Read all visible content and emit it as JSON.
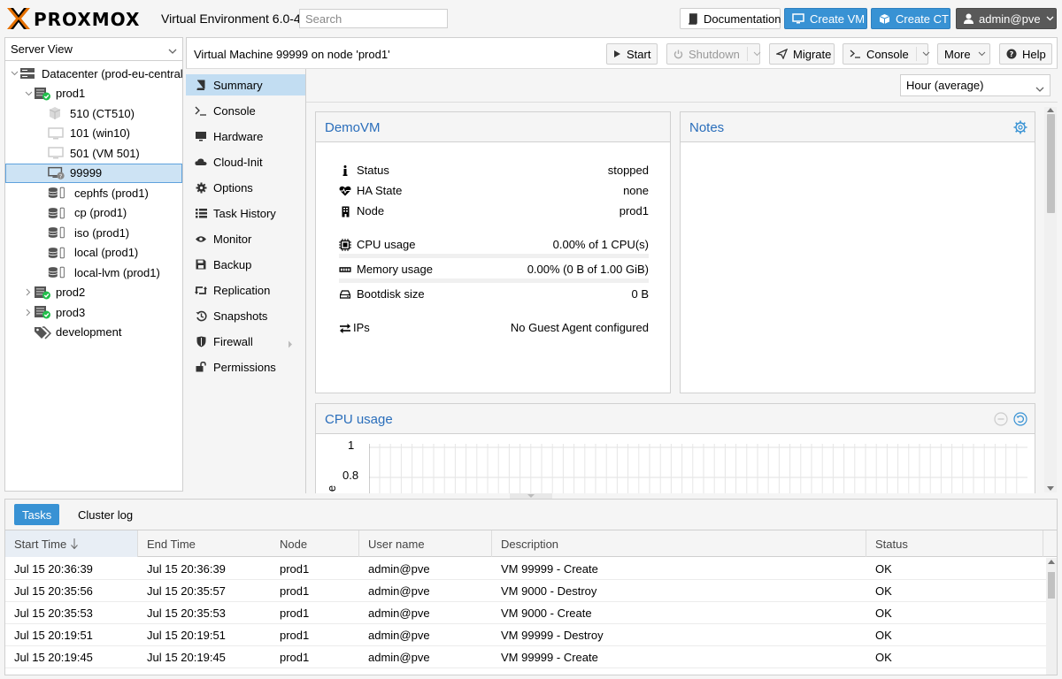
{
  "header": {
    "logo_text": "PROXMOX",
    "version": "Virtual Environment 6.0-4",
    "search_placeholder": "Search",
    "documentation_label": "Documentation",
    "create_vm_label": "Create VM",
    "create_ct_label": "Create CT",
    "user_label": "admin@pve"
  },
  "sidebar": {
    "view": "Server View",
    "tree": [
      {
        "label": "Datacenter (prod-eu-central)",
        "type": "datacenter"
      },
      {
        "label": "prod1",
        "type": "node"
      },
      {
        "label": "510 (CT510)",
        "type": "ct"
      },
      {
        "label": "101 (win10)",
        "type": "vm"
      },
      {
        "label": "501 (VM 501)",
        "type": "vm"
      },
      {
        "label": "99999",
        "type": "vm-unknown",
        "selected": true
      },
      {
        "label": "cephfs (prod1)",
        "type": "storage"
      },
      {
        "label": "cp (prod1)",
        "type": "storage"
      },
      {
        "label": "iso (prod1)",
        "type": "storage"
      },
      {
        "label": "local (prod1)",
        "type": "storage"
      },
      {
        "label": "local-lvm (prod1)",
        "type": "storage"
      },
      {
        "label": "prod2",
        "type": "node"
      },
      {
        "label": "prod3",
        "type": "node"
      },
      {
        "label": "development",
        "type": "tag"
      }
    ]
  },
  "toolbar": {
    "title": "Virtual Machine 99999 on node 'prod1'",
    "start_label": "Start",
    "shutdown_label": "Shutdown",
    "migrate_label": "Migrate",
    "console_label": "Console",
    "more_label": "More",
    "help_label": "Help"
  },
  "submenu": {
    "items": [
      {
        "label": "Summary",
        "icon": "book-icon",
        "active": true
      },
      {
        "label": "Console",
        "icon": "terminal-icon"
      },
      {
        "label": "Hardware",
        "icon": "desktop-icon"
      },
      {
        "label": "Cloud-Init",
        "icon": "cloud-icon"
      },
      {
        "label": "Options",
        "icon": "gear-icon"
      },
      {
        "label": "Task History",
        "icon": "list-icon"
      },
      {
        "label": "Monitor",
        "icon": "eye-icon"
      },
      {
        "label": "Backup",
        "icon": "floppy-icon"
      },
      {
        "label": "Replication",
        "icon": "retweet-icon"
      },
      {
        "label": "Snapshots",
        "icon": "history-icon"
      },
      {
        "label": "Firewall",
        "icon": "shield-icon"
      },
      {
        "label": "Permissions",
        "icon": "unlock-icon"
      }
    ]
  },
  "summary": {
    "timeframe": "Hour (average)",
    "panel_title": "DemoVM",
    "notes_title": "Notes",
    "rows": {
      "status": {
        "key": "Status",
        "value": "stopped"
      },
      "ha": {
        "key": "HA State",
        "value": "none"
      },
      "node": {
        "key": "Node",
        "value": "prod1"
      },
      "cpu": {
        "key": "CPU usage",
        "value": "0.00% of 1 CPU(s)"
      },
      "mem": {
        "key": "Memory usage",
        "value": "0.00% (0 B of 1.00 GiB)"
      },
      "disk": {
        "key": "Bootdisk size",
        "value": "0 B"
      },
      "ips": {
        "key": "IPs",
        "value": "No Guest Agent configured"
      }
    },
    "usage": {
      "cpu_percent": 0,
      "memory_percent": 0
    },
    "cpu_panel": {
      "title": "CPU usage",
      "y_ticks": [
        "1",
        "0.8"
      ],
      "ylabel_fragment": "e"
    }
  },
  "tasks": {
    "tabs": [
      {
        "label": "Tasks",
        "active": true
      },
      {
        "label": "Cluster log"
      }
    ],
    "columns": [
      "Start Time",
      "End Time",
      "Node",
      "User name",
      "Description",
      "Status"
    ],
    "rows": [
      {
        "start": "Jul 15 20:36:39",
        "end": "Jul 15 20:36:39",
        "node": "prod1",
        "user": "admin@pve",
        "desc": "VM 99999 - Create",
        "status": "OK"
      },
      {
        "start": "Jul 15 20:35:56",
        "end": "Jul 15 20:35:57",
        "node": "prod1",
        "user": "admin@pve",
        "desc": "VM 9000 - Destroy",
        "status": "OK"
      },
      {
        "start": "Jul 15 20:35:53",
        "end": "Jul 15 20:35:53",
        "node": "prod1",
        "user": "admin@pve",
        "desc": "VM 9000 - Create",
        "status": "OK"
      },
      {
        "start": "Jul 15 20:19:51",
        "end": "Jul 15 20:19:51",
        "node": "prod1",
        "user": "admin@pve",
        "desc": "VM 99999 - Destroy",
        "status": "OK"
      },
      {
        "start": "Jul 15 20:19:45",
        "end": "Jul 15 20:19:45",
        "node": "prod1",
        "user": "admin@pve",
        "desc": "VM 99999 - Create",
        "status": "OK"
      }
    ]
  },
  "colors": {
    "accent": "#3892d4",
    "title_blue": "#2a6ebb",
    "selected_bg": "#cde3f4",
    "status_ok": "#21bf4b",
    "brand_orange": "#e57000"
  }
}
